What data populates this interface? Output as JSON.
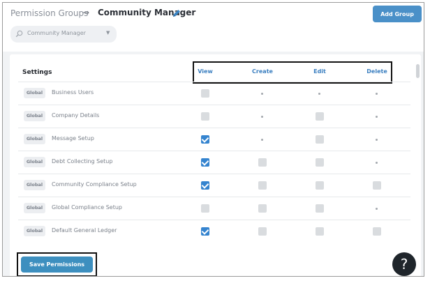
{
  "header": {
    "breadcrumb_root": "Permission Groups",
    "breadcrumb_arrow": "→",
    "breadcrumb_current": "Community Manager",
    "add_group_label": "Add Group",
    "group_select_value": "Community Manager"
  },
  "table": {
    "title": "Settings",
    "columns": [
      "View",
      "Create",
      "Edit",
      "Delete"
    ],
    "rows": [
      {
        "scope": "Global",
        "label": "Business Users",
        "cells": [
          "off",
          "dot",
          "dot",
          "dot"
        ]
      },
      {
        "scope": "Global",
        "label": "Company Details",
        "cells": [
          "off",
          "dot",
          "off",
          "dot"
        ]
      },
      {
        "scope": "Global",
        "label": "Message Setup",
        "cells": [
          "on",
          "dot",
          "off",
          "dot"
        ]
      },
      {
        "scope": "Global",
        "label": "Debt Collecting Setup",
        "cells": [
          "on",
          "off",
          "off",
          "dot"
        ]
      },
      {
        "scope": "Global",
        "label": "Community Compliance Setup",
        "cells": [
          "on",
          "off",
          "off",
          "off"
        ]
      },
      {
        "scope": "Global",
        "label": "Global Compliance Setup",
        "cells": [
          "off",
          "off",
          "off",
          "dot"
        ]
      },
      {
        "scope": "Global",
        "label": "Default General Ledger",
        "cells": [
          "on",
          "off",
          "off",
          "off"
        ]
      }
    ]
  },
  "footer": {
    "save_label": "Save Permissions",
    "help_label": "?"
  },
  "colors": {
    "accent": "#3584cf",
    "button": "#4a90c8",
    "help_bg": "#1f252b"
  }
}
